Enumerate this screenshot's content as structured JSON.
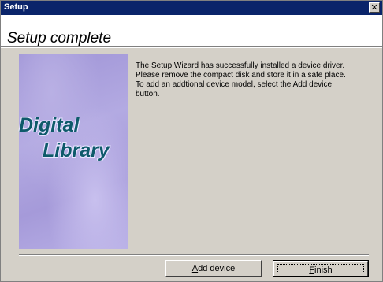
{
  "window": {
    "title": "Setup",
    "close_glyph": "✕"
  },
  "header": {
    "heading": "Setup complete"
  },
  "side_image": {
    "logo_line1": "Digital",
    "logo_line2": "Library",
    "colors": {
      "background": "#a79ddb",
      "logo_text": "#0e5a6a"
    }
  },
  "body": {
    "message": "The Setup Wizard has successfully installed a device driver.\nPlease remove the compact disk and store it in a safe place.\nTo add an addtional device model, select the Add device\nbutton."
  },
  "buttons": {
    "add_device": {
      "mnemonic": "A",
      "rest": "dd device"
    },
    "finish": {
      "mnemonic": "F",
      "rest": "inish"
    }
  },
  "colors": {
    "title_bar": "#0a246a",
    "dialog_face": "#d4d0c8",
    "header_bg": "#ffffff"
  }
}
